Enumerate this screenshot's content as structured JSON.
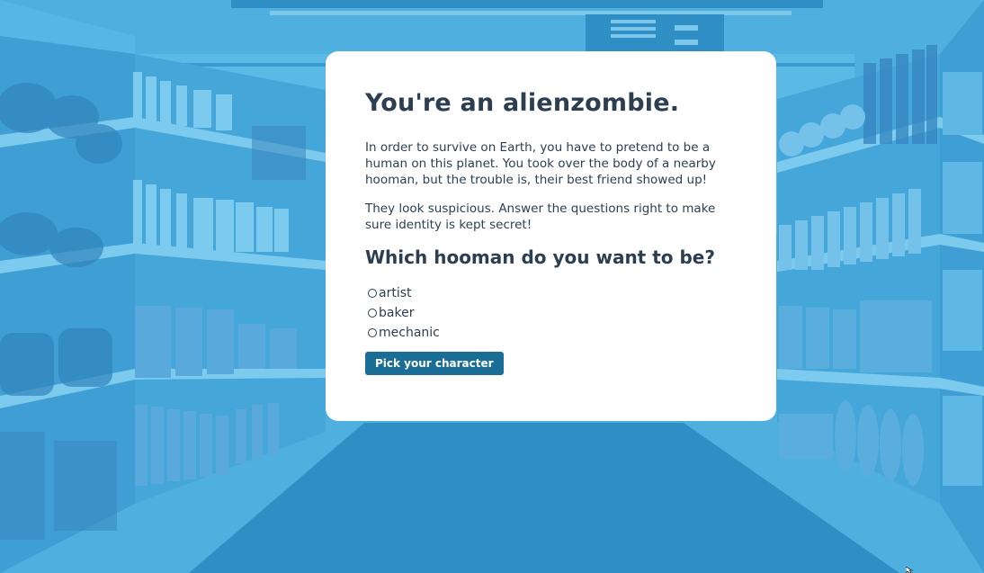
{
  "colors": {
    "background": "#4aaee0",
    "floor": "#2f8ec4",
    "card": "#ffffff",
    "text": "#2c3e50",
    "button": "#1a6e96"
  },
  "quiz": {
    "title": "You're an alienzombie.",
    "intro": "In order to survive on Earth, you have to pretend to be a human on this planet. You took over the body of a nearby hooman, but the trouble is, their best friend showed up!",
    "instructions": "They look suspicious. Answer the questions right to make sure identity is kept secret!",
    "question": "Which hooman do you want to be?",
    "options": [
      "artist",
      "baker",
      "mechanic"
    ],
    "submit_label": "Pick your character"
  }
}
